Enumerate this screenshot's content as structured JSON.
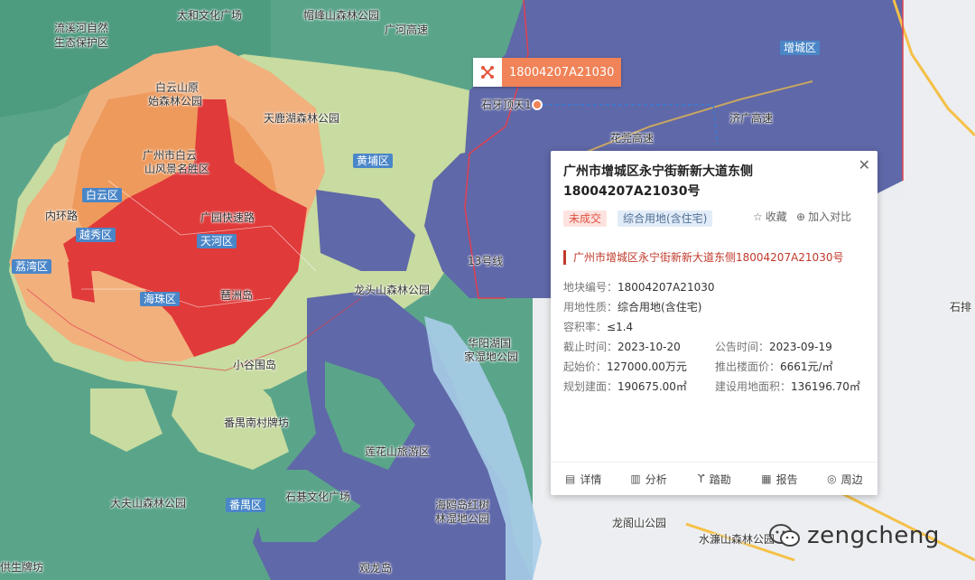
{
  "map": {
    "labels": {
      "liuxi": "流溪河自然",
      "liuxi2": "生态保护区",
      "taihe": "太和文化广场",
      "maofeng": "帽峰山森林公园",
      "guanghe": "广河高速",
      "baiyun_yuan": "白云山原",
      "baiyun_yuan2": "始森林公园",
      "tianlu": "天鹿湖森林公园",
      "gz_baiyun": "广州市白云",
      "gz_baiyun2": "山风景名胜区",
      "neihuan": "内环路",
      "guangyuan": "广园快速路",
      "shiya": "石牙顶天1",
      "huaguan": "花莞高速",
      "jiguang": "济广高速",
      "longtou": "龙头山森林公园",
      "line3": "13号线",
      "huayang": "华阳湖国",
      "huayang2": "家湿地公园",
      "xiaoguwei": "小谷围岛",
      "nancun": "番禺南村牌坊",
      "lianhua": "莲花山旅游区",
      "dafu": "大夫山森林公园",
      "shiji": "石碁文化广场",
      "haiou": "海鸥岛红树",
      "haiou2": "林湿地公园",
      "longge": "龙阁山公园",
      "shuilian": "水濂山森林公园",
      "shipai": "石排",
      "gongsheng": "供生牌坊",
      "guanlong": "观龙岛"
    },
    "districts": {
      "zengcheng": "增城区",
      "huangpu": "黄埔区",
      "baiyun": "白云区",
      "yuexiu": "越秀区",
      "tianhe": "天河区",
      "liwan": "荔湾区",
      "haizhu": "海珠区",
      "pazhou": "琶洲岛",
      "panyu": "番禺区"
    }
  },
  "marker": {
    "code": "18004207A21030",
    "icon": "cross-marker-icon"
  },
  "panel": {
    "title": "广州市增城区永宁街新新大道东侧18004207A21030号",
    "status_tag": "未成交",
    "type_tag": "综合用地(含住宅)",
    "favorite_label": "收藏",
    "compare_label": "加入对比",
    "sub_title": "广州市增城区永宁街新新大道东侧18004207A21030号",
    "fields": {
      "plot_no_label": "地块编号：",
      "plot_no": "18004207A21030",
      "usage_label": "用地性质：",
      "usage": "综合用地(含住宅)",
      "far_label": "容积率：",
      "far": "≤1.4",
      "deadline_label": "截止时间：",
      "deadline": "2023-10-20",
      "announce_label": "公告时间：",
      "announce": "2023-09-19",
      "start_price_label": "起始价：",
      "start_price": "127000.00万元",
      "floor_price_label": "推出楼面价：",
      "floor_price": "6661元/㎡",
      "planned_area_label": "规划建面：",
      "planned_area": "190675.00㎡",
      "land_area_label": "建设用地面积：",
      "land_area": "136196.70㎡"
    },
    "footer": [
      "详情",
      "分析",
      "踏勘",
      "报告",
      "周边"
    ]
  },
  "watermark": {
    "text": "zengcheng"
  }
}
